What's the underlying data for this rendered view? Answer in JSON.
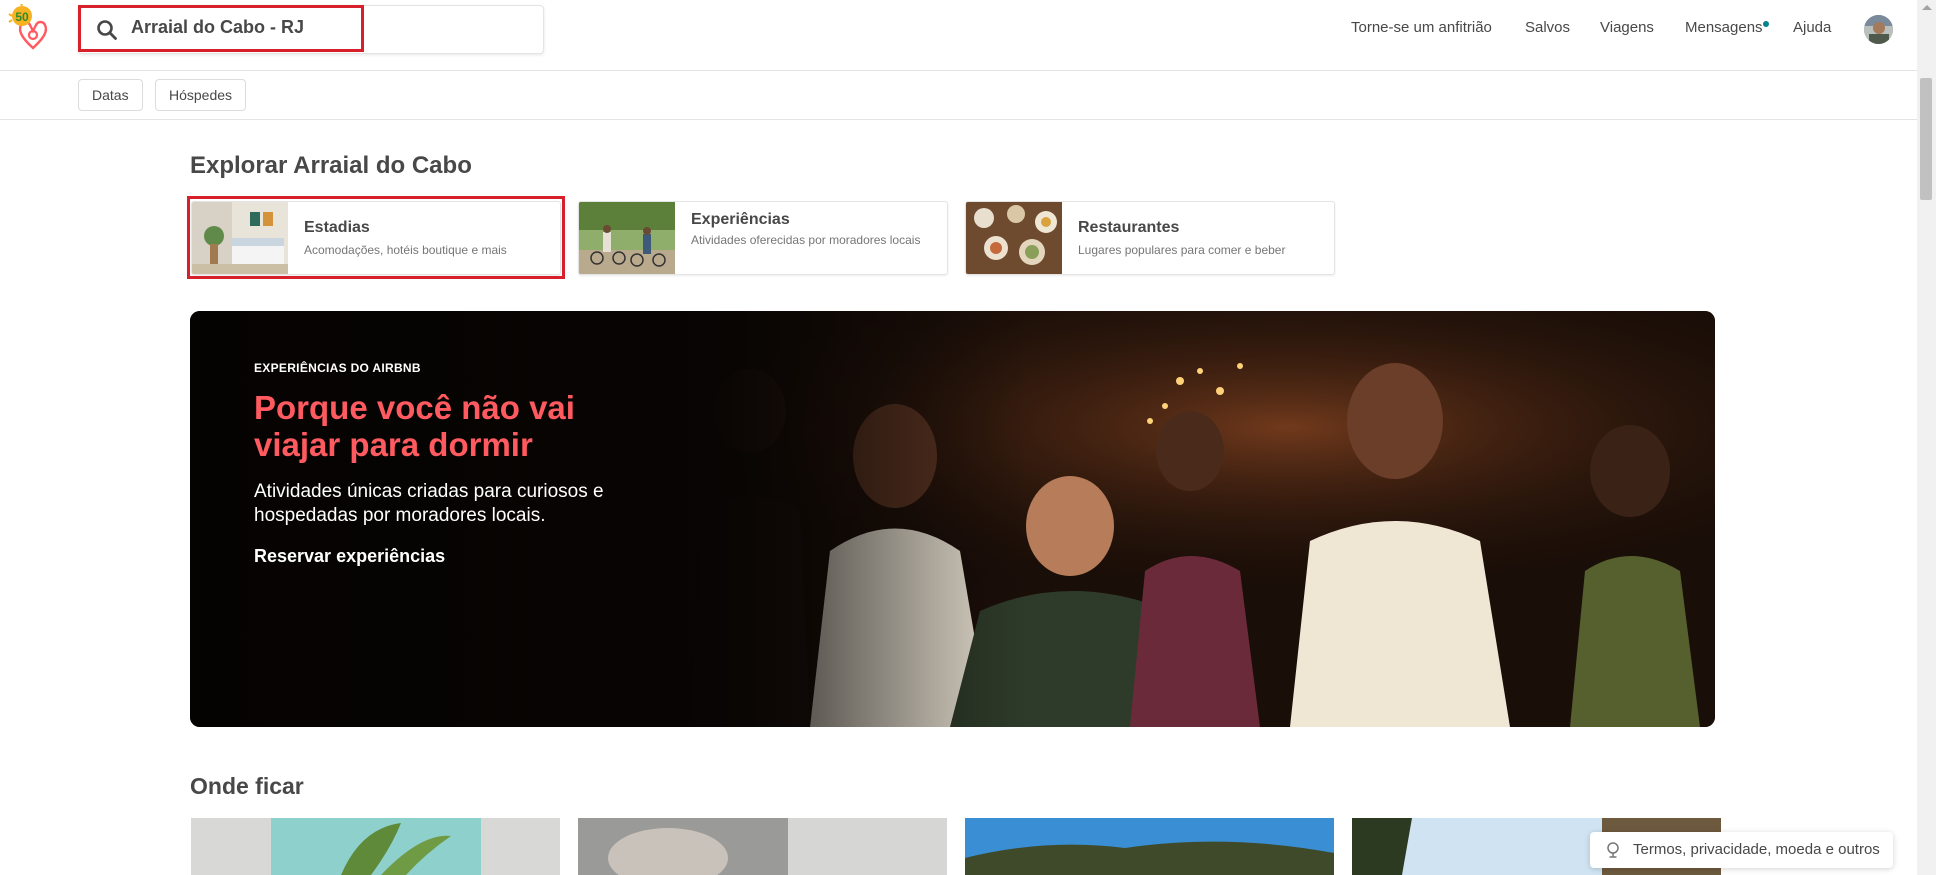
{
  "search": {
    "query": "Arraial do Cabo - RJ"
  },
  "logo": {
    "badge": "50"
  },
  "nav": {
    "host": "Torne-se um anfitrião",
    "saved": "Salvos",
    "trips": "Viagens",
    "messages": "Mensagens",
    "help": "Ajuda"
  },
  "filters": {
    "dates": "Datas",
    "guests": "Hóspedes"
  },
  "explore": {
    "title": "Explorar Arraial do Cabo",
    "categories": [
      {
        "title": "Estadias",
        "subtitle": "Acomodações, hotéis boutique e mais"
      },
      {
        "title": "Experiências",
        "subtitle": "Atividades oferecidas por moradores locais"
      },
      {
        "title": "Restaurantes",
        "subtitle": "Lugares populares para comer e beber"
      }
    ]
  },
  "hero": {
    "eyebrow": "EXPERIÊNCIAS DO AIRBNB",
    "title": "Porque você não vai viajar para dormir",
    "subtitle": "Atividades únicas criadas para curiosos e hospedadas por moradores locais.",
    "link": "Reservar experiências"
  },
  "stay": {
    "title": "Onde ficar"
  },
  "footer": {
    "label": "Termos, privacidade, moeda e outros"
  },
  "colors": {
    "brand": "#ff5a5f",
    "highlight": "#d6202b",
    "notification": "#008489"
  },
  "icons": [
    "airbnb-logo-icon",
    "search-icon",
    "globe-icon"
  ]
}
